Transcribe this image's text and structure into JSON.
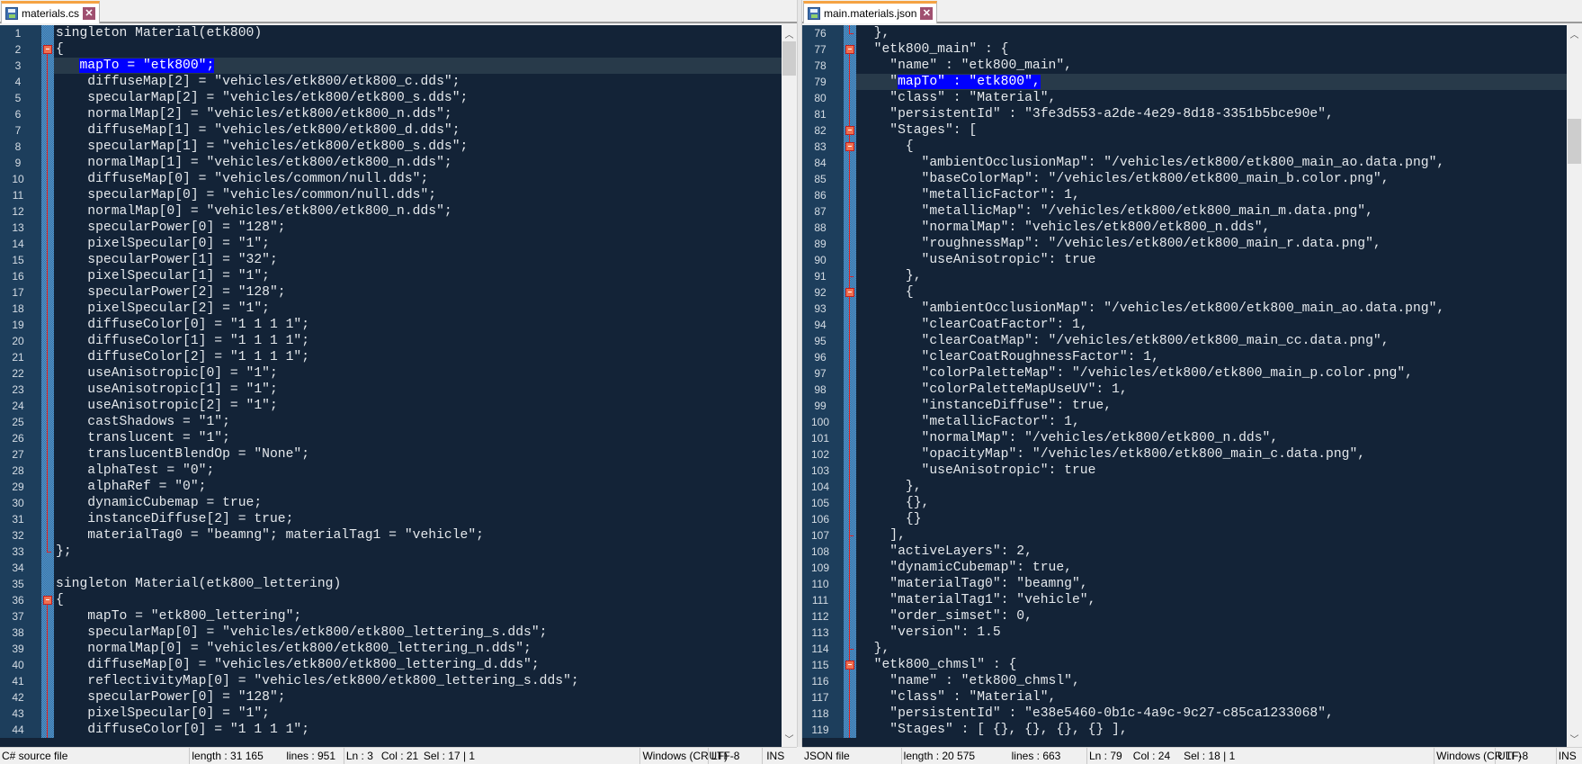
{
  "left": {
    "tab": "materials.cs",
    "current_line": 3,
    "lines": [
      {
        "n": 1,
        "t": "singleton Material(etk800)"
      },
      {
        "n": 2,
        "t": "{",
        "fold": "box"
      },
      {
        "n": 3,
        "t": "   ",
        "sel": "mapTo = \"etk800\";",
        "post": ""
      },
      {
        "n": 4,
        "t": "    diffuseMap[2] = \"vehicles/etk800/etk800_c.dds\";"
      },
      {
        "n": 5,
        "t": "    specularMap[2] = \"vehicles/etk800/etk800_s.dds\";"
      },
      {
        "n": 6,
        "t": "    normalMap[2] = \"vehicles/etk800/etk800_n.dds\";"
      },
      {
        "n": 7,
        "t": "    diffuseMap[1] = \"vehicles/etk800/etk800_d.dds\";"
      },
      {
        "n": 8,
        "t": "    specularMap[1] = \"vehicles/etk800/etk800_s.dds\";"
      },
      {
        "n": 9,
        "t": "    normalMap[1] = \"vehicles/etk800/etk800_n.dds\";"
      },
      {
        "n": 10,
        "t": "    diffuseMap[0] = \"vehicles/common/null.dds\";"
      },
      {
        "n": 11,
        "t": "    specularMap[0] = \"vehicles/common/null.dds\";"
      },
      {
        "n": 12,
        "t": "    normalMap[0] = \"vehicles/etk800/etk800_n.dds\";"
      },
      {
        "n": 13,
        "t": "    specularPower[0] = \"128\";"
      },
      {
        "n": 14,
        "t": "    pixelSpecular[0] = \"1\";"
      },
      {
        "n": 15,
        "t": "    specularPower[1] = \"32\";"
      },
      {
        "n": 16,
        "t": "    pixelSpecular[1] = \"1\";"
      },
      {
        "n": 17,
        "t": "    specularPower[2] = \"128\";"
      },
      {
        "n": 18,
        "t": "    pixelSpecular[2] = \"1\";"
      },
      {
        "n": 19,
        "t": "    diffuseColor[0] = \"1 1 1 1\";"
      },
      {
        "n": 20,
        "t": "    diffuseColor[1] = \"1 1 1 1\";"
      },
      {
        "n": 21,
        "t": "    diffuseColor[2] = \"1 1 1 1\";"
      },
      {
        "n": 22,
        "t": "    useAnisotropic[0] = \"1\";"
      },
      {
        "n": 23,
        "t": "    useAnisotropic[1] = \"1\";"
      },
      {
        "n": 24,
        "t": "    useAnisotropic[2] = \"1\";"
      },
      {
        "n": 25,
        "t": "    castShadows = \"1\";"
      },
      {
        "n": 26,
        "t": "    translucent = \"1\";"
      },
      {
        "n": 27,
        "t": "    translucentBlendOp = \"None\";"
      },
      {
        "n": 28,
        "t": "    alphaTest = \"0\";"
      },
      {
        "n": 29,
        "t": "    alphaRef = \"0\";"
      },
      {
        "n": 30,
        "t": "    dynamicCubemap = true;"
      },
      {
        "n": 31,
        "t": "    instanceDiffuse[2] = true;"
      },
      {
        "n": 32,
        "t": "    materialTag0 = \"beamng\"; materialTag1 = \"vehicle\";"
      },
      {
        "n": 33,
        "t": "};",
        "fold": "end"
      },
      {
        "n": 34,
        "t": ""
      },
      {
        "n": 35,
        "t": "singleton Material(etk800_lettering)"
      },
      {
        "n": 36,
        "t": "{",
        "fold": "box"
      },
      {
        "n": 37,
        "t": "    mapTo = \"etk800_lettering\";"
      },
      {
        "n": 38,
        "t": "    specularMap[0] = \"vehicles/etk800/etk800_lettering_s.dds\";"
      },
      {
        "n": 39,
        "t": "    normalMap[0] = \"vehicles/etk800/etk800_lettering_n.dds\";"
      },
      {
        "n": 40,
        "t": "    diffuseMap[0] = \"vehicles/etk800/etk800_lettering_d.dds\";"
      },
      {
        "n": 41,
        "t": "    reflectivityMap[0] = \"vehicles/etk800/etk800_lettering_s.dds\";"
      },
      {
        "n": 42,
        "t": "    specularPower[0] = \"128\";"
      },
      {
        "n": 43,
        "t": "    pixelSpecular[0] = \"1\";"
      },
      {
        "n": 44,
        "t": "    diffuseColor[0] = \"1 1 1 1\";"
      }
    ],
    "status": {
      "type": "C# source file",
      "length": "length : 31 165",
      "lines": "lines : 951",
      "ln": "Ln : 3",
      "col": "Col : 21",
      "sel": "Sel : 17 | 1",
      "eol": "Windows (CR LF)",
      "enc": "UTF-8",
      "mode": "INS"
    }
  },
  "right": {
    "tab": "main.materials.json",
    "current_line": 79,
    "lines": [
      {
        "n": 76,
        "t": "  },",
        "fold": "end"
      },
      {
        "n": 77,
        "t": "  \"etk800_main\" : {",
        "fold": "box"
      },
      {
        "n": 78,
        "t": "    \"name\" : \"etk800_main\","
      },
      {
        "n": 79,
        "t": "    \"",
        "sel": "mapTo\" : \"etk800\",",
        "post": ""
      },
      {
        "n": 80,
        "t": "    \"class\" : \"Material\","
      },
      {
        "n": 81,
        "t": "    \"persistentId\" : \"3fe3d553-a2de-4e29-8d18-3351b5bce90e\","
      },
      {
        "n": 82,
        "t": "    \"Stages\": [",
        "fold": "box"
      },
      {
        "n": 83,
        "t": "      {",
        "fold": "box"
      },
      {
        "n": 84,
        "t": "        \"ambientOcclusionMap\": \"/vehicles/etk800/etk800_main_ao.data.png\","
      },
      {
        "n": 85,
        "t": "        \"baseColorMap\": \"/vehicles/etk800/etk800_main_b.color.png\","
      },
      {
        "n": 86,
        "t": "        \"metallicFactor\": 1,"
      },
      {
        "n": 87,
        "t": "        \"metallicMap\": \"/vehicles/etk800/etk800_main_m.data.png\","
      },
      {
        "n": 88,
        "t": "        \"normalMap\": \"vehicles/etk800/etk800_n.dds\","
      },
      {
        "n": 89,
        "t": "        \"roughnessMap\": \"/vehicles/etk800/etk800_main_r.data.png\","
      },
      {
        "n": 90,
        "t": "        \"useAnisotropic\": true"
      },
      {
        "n": 91,
        "t": "      },",
        "fold": "end"
      },
      {
        "n": 92,
        "t": "      {",
        "fold": "box"
      },
      {
        "n": 93,
        "t": "        \"ambientOcclusionMap\": \"/vehicles/etk800/etk800_main_ao.data.png\","
      },
      {
        "n": 94,
        "t": "        \"clearCoatFactor\": 1,"
      },
      {
        "n": 95,
        "t": "        \"clearCoatMap\": \"/vehicles/etk800/etk800_main_cc.data.png\","
      },
      {
        "n": 96,
        "t": "        \"clearCoatRoughnessFactor\": 1,"
      },
      {
        "n": 97,
        "t": "        \"colorPaletteMap\": \"/vehicles/etk800/etk800_main_p.color.png\","
      },
      {
        "n": 98,
        "t": "        \"colorPaletteMapUseUV\": 1,"
      },
      {
        "n": 99,
        "t": "        \"instanceDiffuse\": true,"
      },
      {
        "n": 100,
        "t": "        \"metallicFactor\": 1,"
      },
      {
        "n": 101,
        "t": "        \"normalMap\": \"/vehicles/etk800/etk800_n.dds\","
      },
      {
        "n": 102,
        "t": "        \"opacityMap\": \"/vehicles/etk800/etk800_main_c.data.png\","
      },
      {
        "n": 103,
        "t": "        \"useAnisotropic\": true"
      },
      {
        "n": 104,
        "t": "      },"
      },
      {
        "n": 105,
        "t": "      {},"
      },
      {
        "n": 106,
        "t": "      {}"
      },
      {
        "n": 107,
        "t": "    ],",
        "fold": "end"
      },
      {
        "n": 108,
        "t": "    \"activeLayers\": 2,"
      },
      {
        "n": 109,
        "t": "    \"dynamicCubemap\": true,"
      },
      {
        "n": 110,
        "t": "    \"materialTag0\": \"beamng\","
      },
      {
        "n": 111,
        "t": "    \"materialTag1\": \"vehicle\","
      },
      {
        "n": 112,
        "t": "    \"order_simset\": 0,"
      },
      {
        "n": 113,
        "t": "    \"version\": 1.5"
      },
      {
        "n": 114,
        "t": "  },",
        "fold": "end"
      },
      {
        "n": 115,
        "t": "  \"etk800_chmsl\" : {",
        "fold": "box"
      },
      {
        "n": 116,
        "t": "    \"name\" : \"etk800_chmsl\","
      },
      {
        "n": 117,
        "t": "    \"class\" : \"Material\","
      },
      {
        "n": 118,
        "t": "    \"persistentId\" : \"e38e5460-0b1c-4a9c-9c27-c85ca1233068\","
      },
      {
        "n": 119,
        "t": "    \"Stages\" : [ {}, {}, {}, {} ],"
      }
    ],
    "status": {
      "type": "JSON file",
      "length": "length : 20 575",
      "lines": "lines : 663",
      "ln": "Ln : 79",
      "col": "Col : 24",
      "sel": "Sel : 18 | 1",
      "eol": "Windows (CR LF)",
      "enc": "UTF-8",
      "mode": "INS"
    }
  }
}
